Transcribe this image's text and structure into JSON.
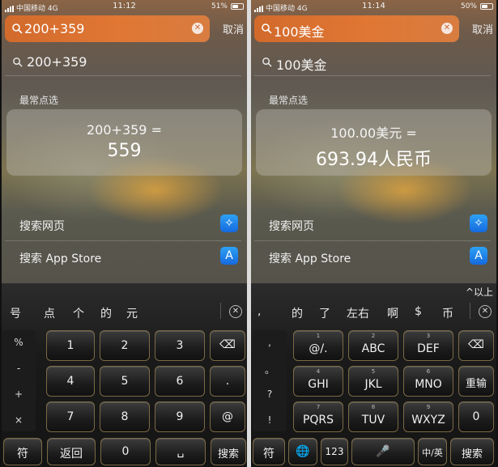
{
  "left": {
    "status": {
      "carrier": "中国移动 4G",
      "time": "11:12",
      "battery": "51%",
      "battery_level": 0.51
    },
    "search": {
      "query": "200+359",
      "cancel": "取消"
    },
    "suggestion": "200+359",
    "section_title": "最常点选",
    "card": {
      "expression": "200+359 =",
      "result": "559"
    },
    "web_rows": [
      {
        "label": "搜索网页",
        "icon": "safari-icon"
      },
      {
        "label": "搜索 App Store",
        "icon": "app-store-icon"
      }
    ],
    "candidates": [
      "号",
      "点",
      "个",
      "的",
      "元"
    ],
    "side_keys": [
      "%",
      "-",
      "+",
      "×"
    ],
    "keys": [
      {
        "label": "1"
      },
      {
        "label": "2"
      },
      {
        "label": "3"
      },
      {
        "label": "⌫"
      },
      {
        "label": "4"
      },
      {
        "label": "5"
      },
      {
        "label": "6"
      },
      {
        "label": "."
      },
      {
        "label": "7"
      },
      {
        "label": "8"
      },
      {
        "label": "9"
      },
      {
        "label": "@"
      }
    ],
    "bottom_keys": [
      "符",
      "返回",
      "0",
      "␣",
      "搜索"
    ]
  },
  "right": {
    "status": {
      "carrier": "中国移动 4G",
      "time": "11:14",
      "battery": "50%",
      "battery_level": 0.5
    },
    "search": {
      "query": "100美金",
      "cancel": "取消"
    },
    "suggestion": "100美金",
    "section_title": "最常点选",
    "card": {
      "expression": "100.00美元 =",
      "result": "693.94人民币"
    },
    "web_rows": [
      {
        "label": "搜索网页",
        "icon": "safari-icon"
      },
      {
        "label": "搜索 App Store",
        "icon": "app-store-icon"
      }
    ],
    "more_label": "^以上",
    "candidates": [
      ",",
      "的",
      "了",
      "左右",
      "啊",
      "$",
      "币"
    ],
    "side_keys": [
      ",",
      "。",
      "?",
      "!"
    ],
    "keys": [
      {
        "num": "1",
        "label": "@/."
      },
      {
        "num": "2",
        "label": "ABC"
      },
      {
        "num": "3",
        "label": "DEF"
      },
      {
        "num": "",
        "label": "⌫"
      },
      {
        "num": "4",
        "label": "GHI"
      },
      {
        "num": "5",
        "label": "JKL"
      },
      {
        "num": "6",
        "label": "MNO"
      },
      {
        "num": "",
        "label": "重输"
      },
      {
        "num": "7",
        "label": "PQRS"
      },
      {
        "num": "8",
        "label": "TUV"
      },
      {
        "num": "9",
        "label": "WXYZ"
      },
      {
        "num": "",
        "label": "0"
      }
    ],
    "bottom_keys": [
      "符",
      "🌐",
      "123",
      "🎤",
      "中/英",
      "搜索"
    ]
  }
}
